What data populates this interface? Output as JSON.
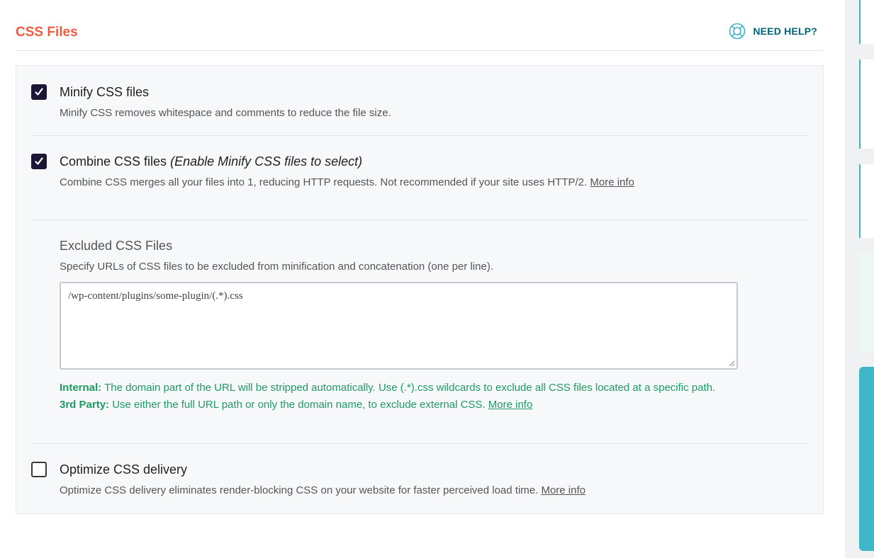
{
  "header": {
    "title": "CSS Files",
    "help_label": "NEED HELP?",
    "help_icon": "lifebuoy-icon"
  },
  "options": {
    "minify": {
      "checked": true,
      "title": "Minify CSS files",
      "description": "Minify CSS removes whitespace and comments to reduce the file size."
    },
    "combine": {
      "checked": true,
      "title": "Combine CSS files",
      "title_note": "(Enable Minify CSS files to select)",
      "description": "Combine CSS merges all your files into 1, reducing HTTP requests. Not recommended if your site uses HTTP/2.",
      "link": "More info"
    },
    "optimize": {
      "checked": false,
      "title": "Optimize CSS delivery",
      "description": "Optimize CSS delivery eliminates render-blocking CSS on your website for faster perceived load time.",
      "link": "More info"
    }
  },
  "excluded": {
    "title": "Excluded CSS Files",
    "description": "Specify URLs of CSS files to be excluded from minification and concatenation (one per line).",
    "value": "/wp-content/plugins/some-plugin/(.*).css",
    "internal_label": "Internal:",
    "internal_text": "The domain part of the URL will be stripped automatically. Use (.*).css wildcards to exclude all CSS files located at a specific path.",
    "third_party_label": "3rd Party:",
    "third_party_text": "Use either the full URL path or only the domain name, to exclude external CSS.",
    "link": "More info"
  },
  "colors": {
    "title": "#f05b3e",
    "help": "#006577",
    "checkbox": "#1c1536",
    "note": "#1e9a64",
    "accent": "#3fb7c6"
  }
}
